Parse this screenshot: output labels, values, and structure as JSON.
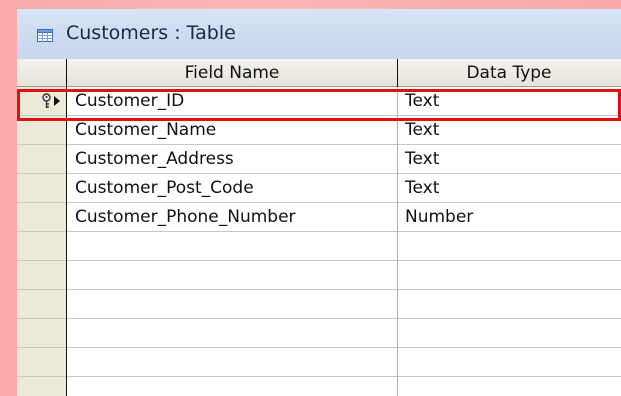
{
  "window": {
    "title": "Customers : Table"
  },
  "columns": {
    "field_name": "Field Name",
    "data_type": "Data Type"
  },
  "rows": [
    {
      "field": "Customer_ID",
      "type": "Text",
      "primary_key": true
    },
    {
      "field": "Customer_Name",
      "type": "Text",
      "primary_key": false
    },
    {
      "field": "Customer_Address",
      "type": "Text",
      "primary_key": false
    },
    {
      "field": "Customer_Post_Code",
      "type": "Text",
      "primary_key": false
    },
    {
      "field": "Customer_Phone_Number",
      "type": "Number",
      "primary_key": false
    }
  ],
  "colors": {
    "highlight": "#e01010",
    "background": "#f9a9aa",
    "titlebar": "#cddbf0"
  },
  "icons": {
    "title": "table-icon",
    "primary_key": "key-icon",
    "current_row": "row-pointer-icon"
  }
}
